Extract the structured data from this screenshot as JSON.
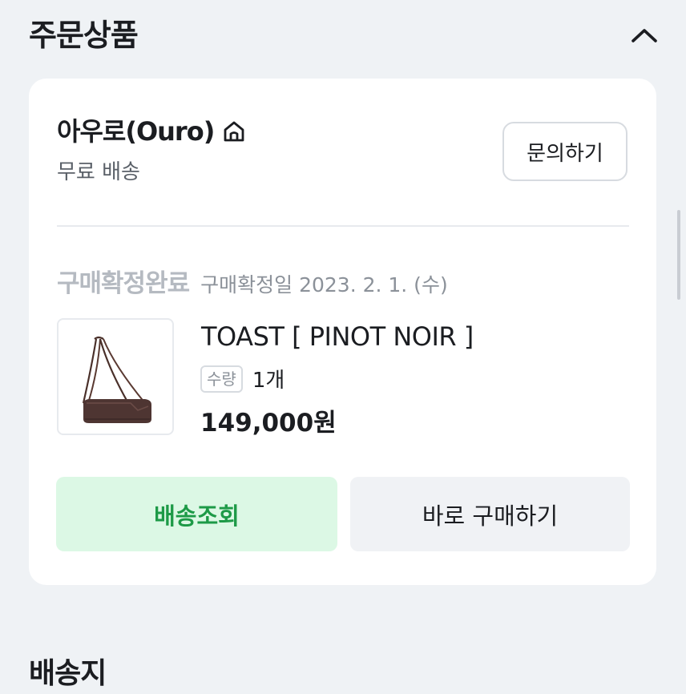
{
  "section": {
    "title": "주문상품"
  },
  "seller": {
    "name": "아우로(Ouro)",
    "shipping": "무료 배송",
    "inquiry_label": "문의하기"
  },
  "order": {
    "status": "구매확정완료",
    "confirm_date": "구매확정일 2023. 2. 1. (수)"
  },
  "product": {
    "name": "TOAST [ PINOT NOIR ]",
    "qty_label": "수량",
    "qty_value": "1개",
    "price": "149,000원"
  },
  "actions": {
    "track_label": "배송조회",
    "buy_again_label": "바로 구매하기"
  },
  "next_section": {
    "title": "배송지"
  },
  "colors": {
    "background": "#eff2f5",
    "card": "#ffffff",
    "accent_green": "#1d9a47",
    "green_button_bg": "#dcf8e5",
    "muted_text": "#8b9199"
  },
  "icons": {
    "collapse": "chevron-up-icon",
    "store": "home-icon"
  }
}
